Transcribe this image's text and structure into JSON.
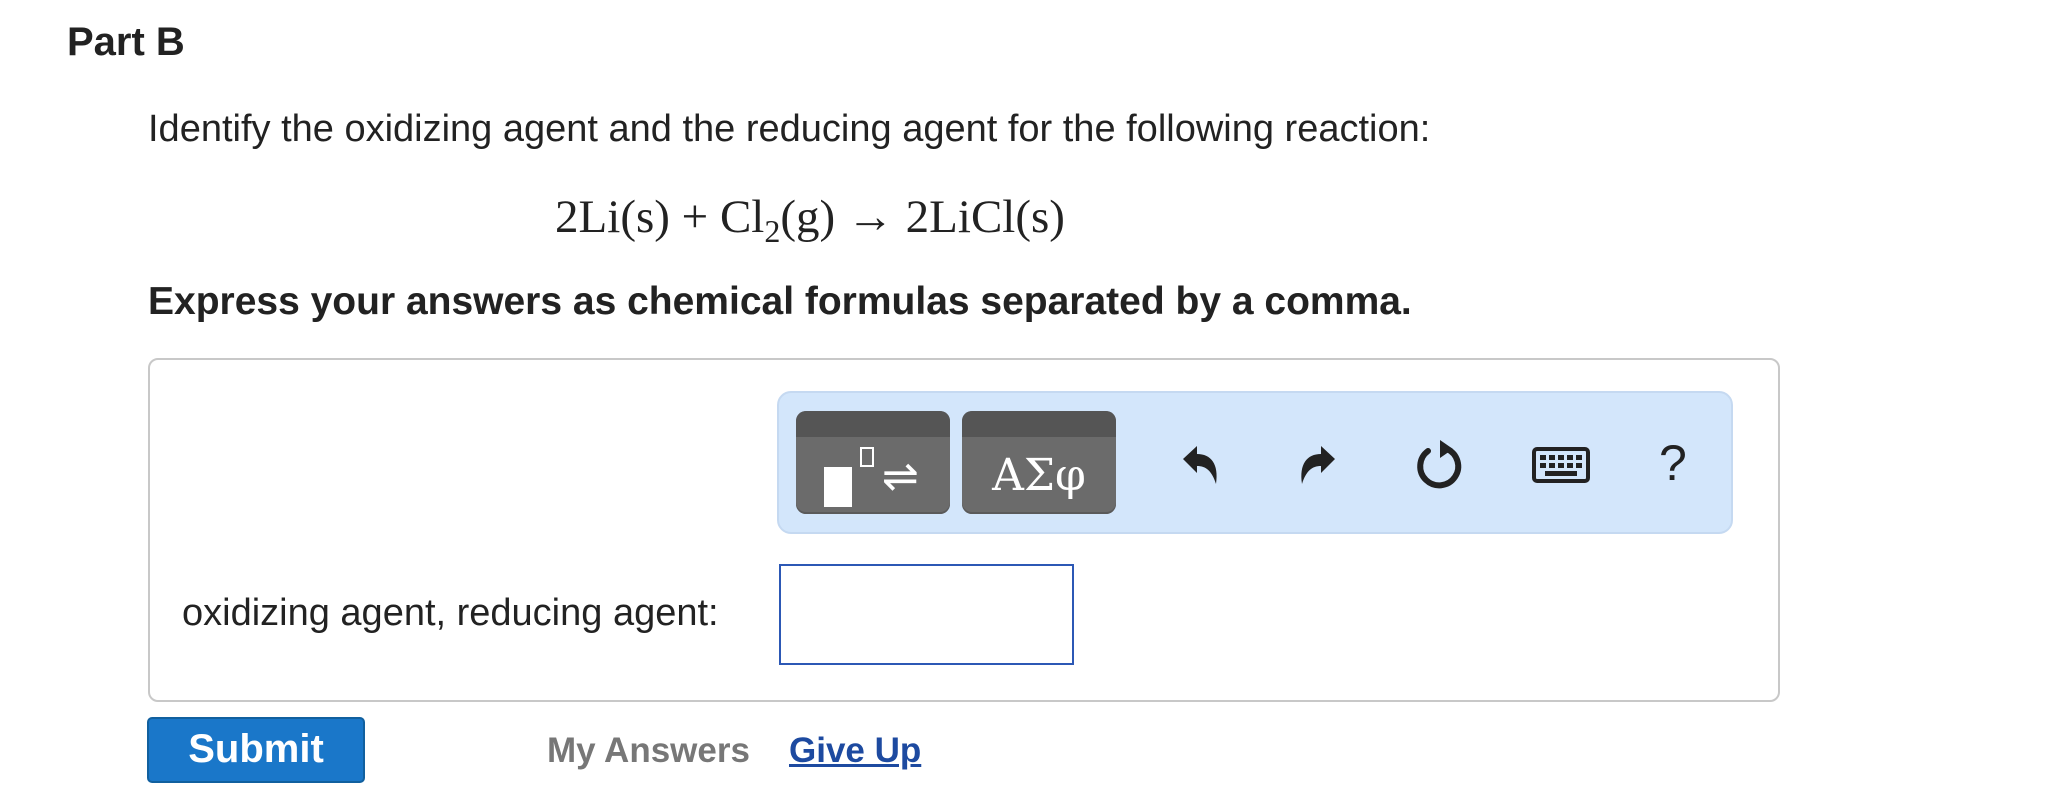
{
  "part_title": "Part B",
  "question": "Identify the oxidizing agent and the reducing agent for the following reaction:",
  "equation": {
    "lhs_term1": "2Li(s)",
    "plus": "+",
    "cl": "Cl",
    "subscript": "2",
    "state_g": "(g)",
    "arrow": "→",
    "rhs": "2LiCl(s)"
  },
  "instruction": "Express your answers as chemical formulas separated by a comma.",
  "toolbar": {
    "templates_icon": "templates-icon",
    "greek_label": "ΑΣφ",
    "undo_icon": "undo-icon",
    "redo_icon": "redo-icon",
    "reset_icon": "reset-icon",
    "keyboard_icon": "keyboard-icon",
    "help_label": "?"
  },
  "answer": {
    "label": "oxidizing agent, reducing agent:",
    "value": "",
    "placeholder": ""
  },
  "actions": {
    "submit_label": "Submit",
    "my_answers_label": "My Answers",
    "give_up_label": "Give Up"
  },
  "colors": {
    "submit_bg": "#1a77c9",
    "toolbar_bg": "#d3e6fb",
    "link": "#1d4aa0",
    "input_border": "#2c58b5"
  }
}
